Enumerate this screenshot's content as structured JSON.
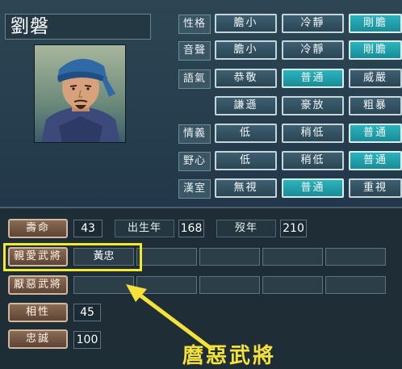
{
  "character": {
    "name": "劉磐"
  },
  "traits": [
    {
      "label": "性格",
      "options": [
        "膽小",
        "冷靜",
        "剛膽"
      ],
      "selected": 2
    },
    {
      "label": "音聲",
      "options": [
        "膽小",
        "冷靜",
        "剛膽"
      ],
      "selected": 2
    },
    {
      "label": "語氣",
      "options": [
        "恭敬",
        "普通",
        "威嚴"
      ],
      "selected": 1
    },
    {
      "label": "",
      "options": [
        "謙遜",
        "豪放",
        "粗暴"
      ],
      "selected": -1
    },
    {
      "label": "情義",
      "options": [
        "低",
        "稍低",
        "普通"
      ],
      "selected": 2
    },
    {
      "label": "野心",
      "options": [
        "低",
        "稍低",
        "普通"
      ],
      "selected": 2
    },
    {
      "label": "漢室",
      "options": [
        "無視",
        "普通",
        "重視"
      ],
      "selected": 1
    }
  ],
  "stats": {
    "lifespan_label": "壽命",
    "lifespan_value": "43",
    "birth_label": "出生年",
    "birth_value": "168",
    "death_label": "歿年",
    "death_value": "210",
    "favored_label": "親愛武將",
    "favored_general": "黃忠",
    "disliked_label": "厭惡武將",
    "compat_label": "相性",
    "compat_value": "45",
    "loyalty_label": "忠誠",
    "loyalty_value": "100"
  },
  "annotation": {
    "text": "麿惡武將"
  },
  "colors": {
    "active": "#29b4bf",
    "highlight": "#f2ea2a",
    "annotation": "#f6e13a",
    "brown_button": "#8a6c55"
  }
}
